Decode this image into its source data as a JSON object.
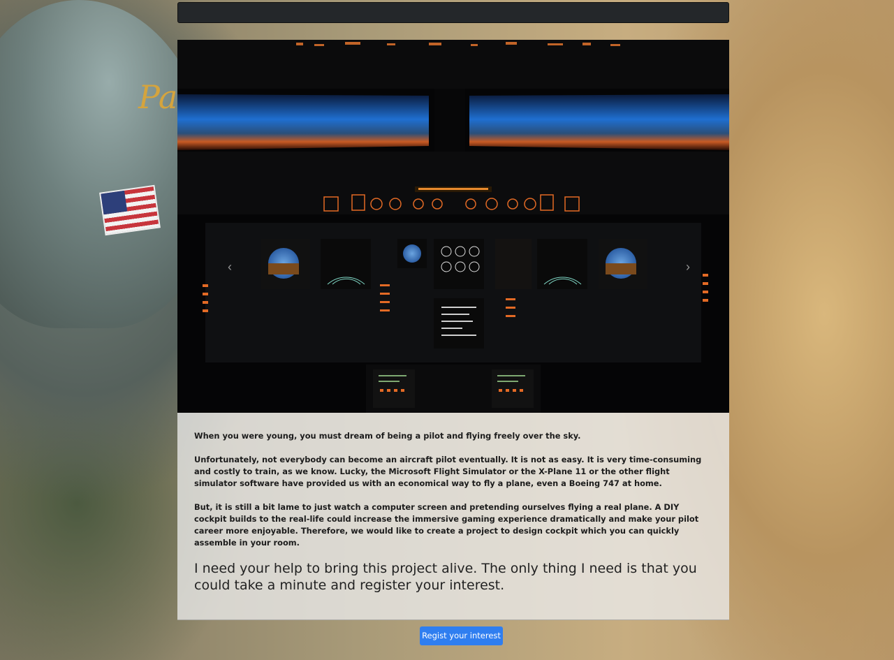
{
  "carousel": {
    "prev_label": "Previous",
    "next_label": "Next",
    "prev_glyph": "‹",
    "next_glyph": "›",
    "slide_count": 3,
    "active_slide": 3,
    "image_subject": "cockpit-panel-image"
  },
  "content": {
    "p1": "When you were young, you must dream of being a pilot and flying freely over the sky.",
    "p2": "Unfortunately, not everybody can become an aircraft pilot eventually. It is not as easy. It is very time-consuming and costly to train, as we know. Lucky, the Microsoft Flight Simulator or the X-Plane 11 or the other flight simulator software have provided us with an economical way to fly a plane, even a Boeing 747 at home.",
    "p3": "But, it is still a bit lame to just watch a computer screen and pretending ourselves flying a real plane. A DIY cockpit builds to the real-life could increase the immersive gaming experience dramatically and make your pilot career more enjoyable. Therefore, we would like to create a project to design cockpit which you can quickly assemble in your room.",
    "lead": "I need your help to bring this project alive. The only thing I need is that you could take a minute and register your interest."
  },
  "cta": {
    "label": "Regist your interest",
    "color": "#2f7ef0"
  },
  "background": {
    "helmet_text": "Pa"
  }
}
